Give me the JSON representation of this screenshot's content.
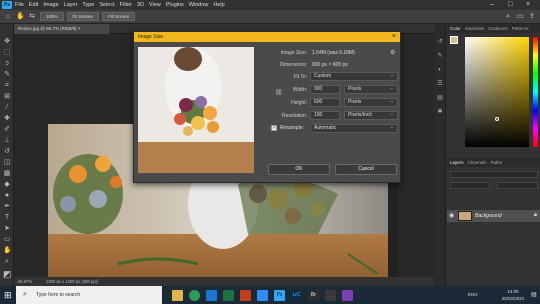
{
  "app": {
    "logo": "Ps",
    "menu": [
      "File",
      "Edit",
      "Image",
      "Layer",
      "Type",
      "Select",
      "Filter",
      "3D",
      "View",
      "Plugins",
      "Window",
      "Help"
    ]
  },
  "options_bar": {
    "zoom_value": "100%",
    "fit_screen": "Fit Screen",
    "fill_screen": "Fill Screen"
  },
  "document": {
    "tab_label": "Resize.jpg @ 66.7% (RGB/8)",
    "status_zoom": "66.67%",
    "status_info": "1800 px x 1200 px (300 ppi)"
  },
  "dialog": {
    "title": "Image Size",
    "image_size_label": "Image Size:",
    "image_size_value": "1.54M (was 6.18M)",
    "dimensions_label": "Dimensions:",
    "dimensions_value": "900 px × 600 px",
    "fit_to_label": "Fit To:",
    "fit_to_value": "Custom",
    "width_label": "Width:",
    "width_value": "900",
    "width_unit": "Pixels",
    "height_label": "Height:",
    "height_value": "600",
    "height_unit": "Pixels",
    "resolution_label": "Resolution:",
    "resolution_value": "100",
    "resolution_unit": "Pixels/Inch",
    "resample_label": "Resample:",
    "resample_value": "Automatic",
    "ok_label": "OK",
    "cancel_label": "Cancel"
  },
  "panels": {
    "color_tabs": [
      "Color",
      "Swatches",
      "Gradients",
      "Patterns"
    ],
    "layer_tabs": [
      "Layers",
      "Channels",
      "Paths"
    ],
    "layer_name": "Background"
  },
  "taskbar": {
    "search_placeholder": "Type here to search",
    "time": "14:05",
    "date": "25/02/2021",
    "lang": "ENG"
  },
  "colors": {
    "accent": "#f2b81b",
    "ps_blue": "#31a8ff"
  }
}
